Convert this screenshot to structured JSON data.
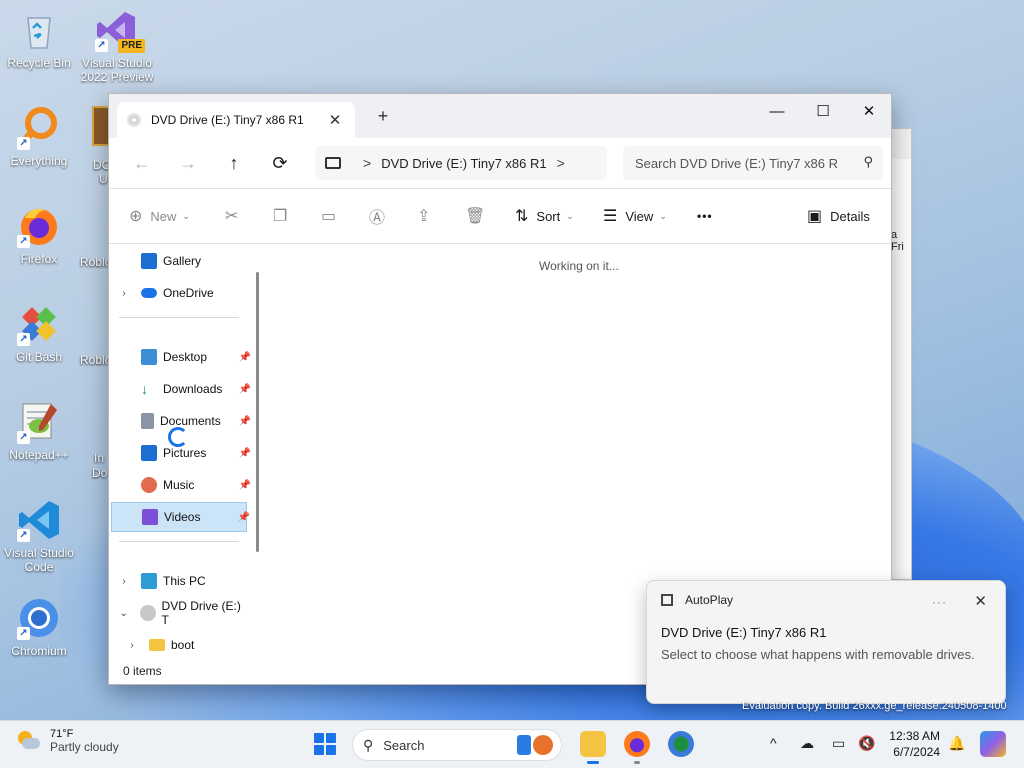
{
  "desktop": {
    "icons": [
      {
        "label": "Recycle Bin"
      },
      {
        "label": "Visual Studio 2022 Preview",
        "badge": "PRE"
      },
      {
        "label": "Everything"
      },
      {
        "label": "Firefox"
      },
      {
        "label": "Git Bash"
      },
      {
        "label": "Notepad++"
      },
      {
        "label": "Visual Studio Code"
      },
      {
        "label": "Chromium"
      }
    ],
    "partial_labels": [
      "DO",
      "U",
      "Roblo",
      "Roblo",
      "In",
      "Do"
    ],
    "background_window_text": "a Fri",
    "evaluation_text": "Evaluation copy. Build 26xxx.ge_release.240508-1400"
  },
  "explorer": {
    "tab_title": "DVD Drive (E:) Tiny7 x86 R1",
    "tab_close": "✕",
    "new_tab": "+",
    "window_buttons": {
      "minimize": "—",
      "maximize": "☐",
      "close": "✕"
    },
    "nav": {
      "back": "←",
      "forward": "→",
      "up": "↑",
      "refresh": "⟳"
    },
    "address": {
      "separator": ">",
      "crumb": "DVD Drive (E:) Tiny7 x86 R1",
      "trailing": ">"
    },
    "search_placeholder": "Search DVD Drive (E:) Tiny7 x86 R",
    "toolbar": {
      "new": "New",
      "sort": "Sort",
      "view": "View",
      "more": "•••",
      "details": "Details"
    },
    "sidebar": [
      {
        "label": "Gallery",
        "color": "#1d6fd1"
      },
      {
        "label": "OneDrive",
        "color": "#1a73e8",
        "expandable": true
      },
      {
        "label": "Desktop",
        "color": "#3a8fd6",
        "pinned": true
      },
      {
        "label": "Downloads",
        "color": "#1e8e3e",
        "pinned": true
      },
      {
        "label": "Documents",
        "color": "#8a94a3",
        "pinned": true
      },
      {
        "label": "Pictures",
        "color": "#1d6fd1",
        "pinned": true
      },
      {
        "label": "Music",
        "color": "#e26a4f",
        "pinned": true
      },
      {
        "label": "Videos",
        "color": "#7b4fd6",
        "pinned": true,
        "selected": true
      },
      {
        "label": "This PC",
        "color": "#2c9bd6",
        "expandable": true
      },
      {
        "label": "DVD Drive (E:) T",
        "color": "#c8c8c8",
        "expanded": true
      },
      {
        "label": "boot",
        "color": "#f4c542",
        "expandable": true
      }
    ],
    "content_message": "Working on it...",
    "status": "0 items"
  },
  "toast": {
    "app": "AutoPlay",
    "more": "···",
    "close": "✕",
    "title": "DVD Drive (E:) Tiny7 x86 R1",
    "body": "Select to choose what happens with removable drives."
  },
  "taskbar": {
    "weather_temp": "71°F",
    "weather_desc": "Partly cloudy",
    "search_label": "Search",
    "time": "12:38 AM",
    "date": "6/7/2024",
    "tray_chevron": "^"
  }
}
